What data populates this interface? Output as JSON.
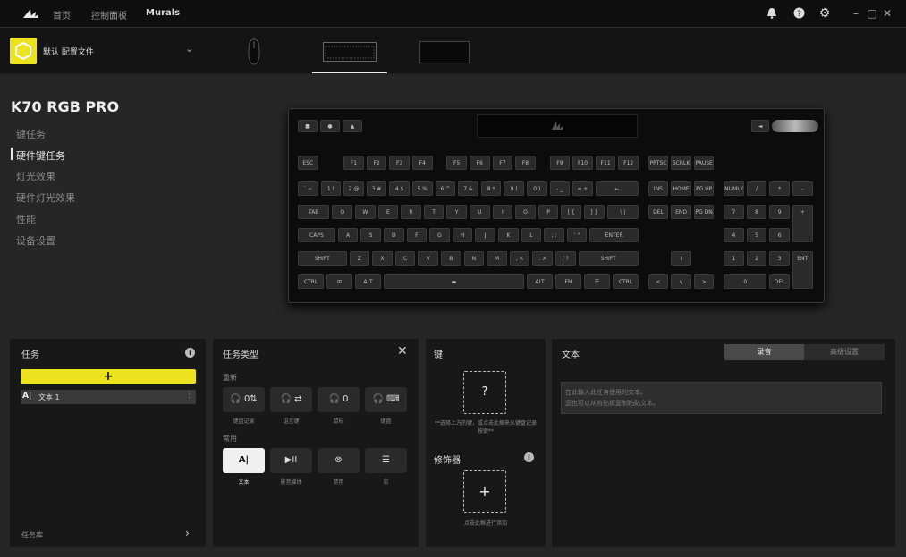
{
  "titlebar": {
    "logo": "corsair-sails-logo",
    "nav": [
      "首页",
      "控制面板",
      "Murals"
    ],
    "icons": [
      "bell-icon",
      "help-icon",
      "gear-icon"
    ],
    "window_controls": [
      "–",
      "□",
      "✕"
    ]
  },
  "profile": {
    "name": "默认 配置文件",
    "accent": "#ECE21D"
  },
  "device": {
    "name": "K70 RGB PRO",
    "menu": [
      "键任务",
      "硬件键任务",
      "灯光效果",
      "硬件灯光效果",
      "性能",
      "设备设置"
    ],
    "selected_menu_index": 1
  },
  "keyboard": {
    "fn_row": [
      "ESC",
      "F1",
      "F2",
      "F3",
      "F4",
      "F5",
      "F6",
      "F7",
      "F8",
      "F9",
      "F10",
      "F11",
      "F12",
      "PRTSC",
      "SCRLK",
      "PAUSE"
    ],
    "num_row": [
      "` ~",
      "1 !",
      "2 @",
      "3 #",
      "4 $",
      "5 %",
      "6 ^",
      "7 &",
      "8 *",
      "9 (",
      "0 )",
      "- _",
      "= +",
      "←",
      "INS",
      "HOME",
      "PG UP",
      "NUMLK",
      "/",
      "*",
      "-"
    ],
    "q_row": [
      "TAB",
      "Q",
      "W",
      "E",
      "R",
      "T",
      "Y",
      "U",
      "I",
      "O",
      "P",
      "[ {",
      "] }",
      "\\ |",
      "DEL",
      "END",
      "PG DN",
      "7",
      "8",
      "9",
      "+"
    ],
    "a_row": [
      "CAPS",
      "A",
      "S",
      "D",
      "F",
      "G",
      "H",
      "J",
      "K",
      "L",
      "; :",
      "' \"",
      "ENTER",
      "4",
      "5",
      "6"
    ],
    "z_row": [
      "SHIFT",
      "Z",
      "X",
      "C",
      "V",
      "B",
      "N",
      "M",
      ", <",
      ". >",
      "/ ?",
      "SHIFT",
      "↑",
      "1",
      "2",
      "3",
      "ENT"
    ],
    "bottom_row": [
      "CTRL",
      "⊞",
      "ALT",
      "▬",
      "ALT",
      "FN",
      "☰",
      "CTRL",
      "<",
      "∨",
      ">",
      "0",
      "DEL"
    ]
  },
  "tasks_panel": {
    "title": "任务",
    "add_label": "+",
    "items": [
      {
        "icon": "A|",
        "label": "文本 1"
      }
    ],
    "library_label": "任务库"
  },
  "task_type_panel": {
    "title": "任务类型",
    "section_remap": "重新",
    "remap_items": [
      {
        "icon": "🎧 0⇅",
        "label": "键盘记录"
      },
      {
        "icon": "🎧 ⇄",
        "label": "语言键"
      },
      {
        "icon": "🎧 0",
        "label": "鼠标"
      },
      {
        "icon": "🎧 ⌨",
        "label": "键盘"
      }
    ],
    "section_common": "常用",
    "common_items": [
      {
        "icon": "A|",
        "label": "文本",
        "active": true
      },
      {
        "icon": "▶II",
        "label": "影音媒体",
        "active": false
      },
      {
        "icon": "⊗",
        "label": "禁用",
        "active": false
      },
      {
        "icon": "☰",
        "label": "宏",
        "active": false
      }
    ]
  },
  "key_panel": {
    "title": "键",
    "key_placeholder": "?",
    "hint": "**选择上方的键，或点击此框来从键盘记录按键**",
    "modifier_title": "修饰器",
    "modifier_add": "+",
    "modifier_hint": "点击此框进行添加"
  },
  "text_panel": {
    "title": "文本",
    "tabs": [
      "录音",
      "高级设置"
    ],
    "active_tab": 0,
    "placeholder_line1": "在此输入此任务使用的文本。",
    "placeholder_line2": "您也可以从剪贴板复制粘贴文本。"
  }
}
